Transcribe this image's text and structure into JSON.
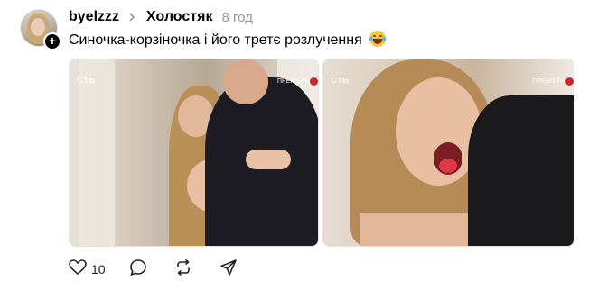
{
  "post": {
    "username": "byelzzz",
    "community": "Холостяк",
    "time": "8 год",
    "text": "Синочка-корзіночка і його третє розлучення",
    "emoji": "tears-of-joy-emoji",
    "likes": "10"
  },
  "media": [
    {
      "name": "kiss-photo",
      "logo": "СТБ",
      "badge": "ПРЕМ'ЄРА"
    },
    {
      "name": "laughing-woman-photo",
      "logo": "СТБ",
      "badge": "ПРЕМ'ЄРА"
    }
  ],
  "icons": {
    "add": "+",
    "chevron": "chevron-right-icon",
    "like": "heart-icon",
    "reply": "comment-icon",
    "repost": "repost-icon",
    "share": "send-icon"
  }
}
